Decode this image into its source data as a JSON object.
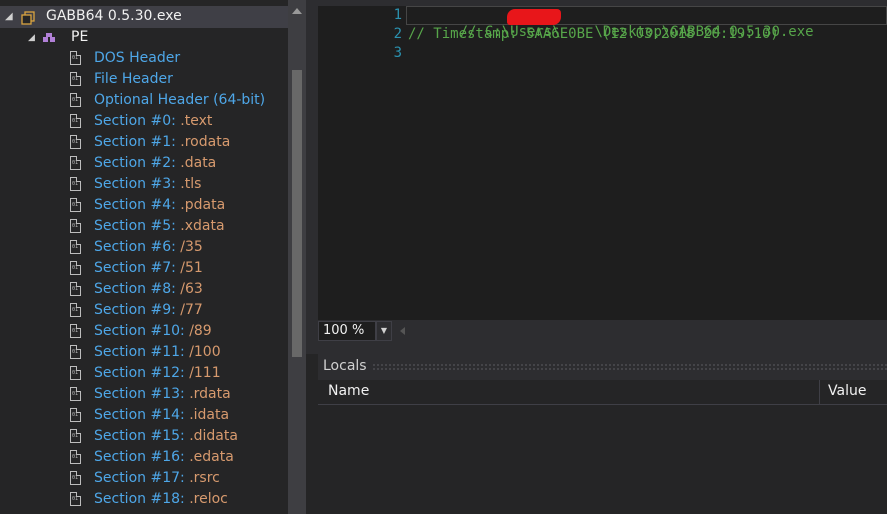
{
  "tree": {
    "root_label": "GABB64 0.5.30.exe",
    "pe_label": "PE",
    "items": [
      {
        "prefix": "DOS Header",
        "suffix": ""
      },
      {
        "prefix": "File Header",
        "suffix": ""
      },
      {
        "prefix": "Optional Header (64-bit)",
        "suffix": ""
      },
      {
        "prefix": "Section #0: ",
        "suffix": ".text"
      },
      {
        "prefix": "Section #1: ",
        "suffix": ".rodata"
      },
      {
        "prefix": "Section #2: ",
        "suffix": ".data"
      },
      {
        "prefix": "Section #3: ",
        "suffix": ".tls"
      },
      {
        "prefix": "Section #4: ",
        "suffix": ".pdata"
      },
      {
        "prefix": "Section #5: ",
        "suffix": ".xdata"
      },
      {
        "prefix": "Section #6: ",
        "suffix": "/35"
      },
      {
        "prefix": "Section #7: ",
        "suffix": "/51"
      },
      {
        "prefix": "Section #8: ",
        "suffix": "/63"
      },
      {
        "prefix": "Section #9: ",
        "suffix": "/77"
      },
      {
        "prefix": "Section #10: ",
        "suffix": "/89"
      },
      {
        "prefix": "Section #11: ",
        "suffix": "/100"
      },
      {
        "prefix": "Section #12: ",
        "suffix": "/111"
      },
      {
        "prefix": "Section #13: ",
        "suffix": ".rdata"
      },
      {
        "prefix": "Section #14: ",
        "suffix": ".idata"
      },
      {
        "prefix": "Section #15: ",
        "suffix": ".didata"
      },
      {
        "prefix": "Section #16: ",
        "suffix": ".edata"
      },
      {
        "prefix": "Section #17: ",
        "suffix": ".rsrc"
      },
      {
        "prefix": "Section #18: ",
        "suffix": ".reloc"
      }
    ]
  },
  "editor": {
    "lines": [
      {
        "num": "1",
        "text": "// C:\\Users\\    \\Desktop\\GABB64 0.5.30.exe"
      },
      {
        "num": "2",
        "text": "// Timestamp: 5AA6E0BE (12.03.2018 20:19:10)"
      },
      {
        "num": "3",
        "text": ""
      }
    ],
    "zoom": "100 %"
  },
  "locals": {
    "title": "Locals",
    "col_name": "Name",
    "col_value": "Value"
  },
  "colors": {
    "comment": "#57a64a",
    "line_number": "#2b91af",
    "tree_link": "#4ea7e8",
    "section_name": "#d79a6e",
    "background": "#1e1e1e"
  }
}
